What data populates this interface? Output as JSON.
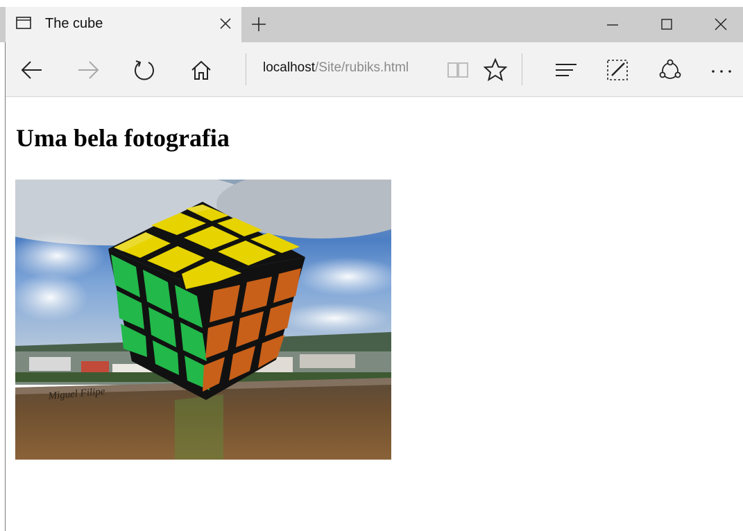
{
  "tab": {
    "title": "The cube"
  },
  "address": {
    "host": "localhost",
    "path": "/Site/rubiks.html"
  },
  "page": {
    "heading": "Uma bela fotografia",
    "photo": {
      "subject": "Rubik's cube on a wooden railing with clouds and town in background",
      "watermark": "Miguel Filipe"
    }
  },
  "colors": {
    "chrome": "#cccccc",
    "toolbar": "#f2f2f2",
    "cube_yellow": "#e6d300",
    "cube_green": "#22b84a",
    "cube_orange": "#c8601a"
  },
  "icons": [
    "tab-page-icon",
    "close-icon",
    "plus-icon",
    "minimize-icon",
    "maximize-icon",
    "window-close-icon",
    "back-arrow-icon",
    "forward-arrow-icon",
    "refresh-icon",
    "home-icon",
    "reading-view-icon",
    "favorite-star-icon",
    "hub-icon",
    "web-note-icon",
    "share-icon",
    "more-icon"
  ]
}
